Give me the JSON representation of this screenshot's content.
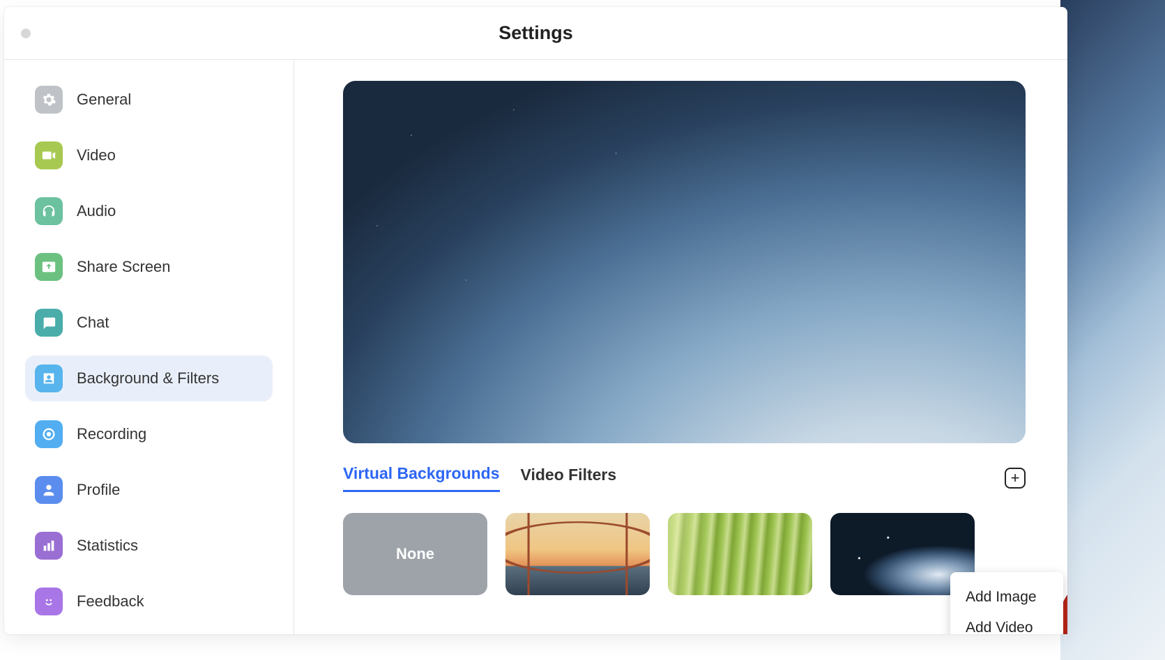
{
  "window": {
    "title": "Settings"
  },
  "sidebar": {
    "items": [
      {
        "label": "General",
        "icon": "gear-icon",
        "color": "#bfc3c8"
      },
      {
        "label": "Video",
        "icon": "video-icon",
        "color": "#a7c951"
      },
      {
        "label": "Audio",
        "icon": "headphones-icon",
        "color": "#6cc19f"
      },
      {
        "label": "Share Screen",
        "icon": "share-screen-icon",
        "color": "#6cc181"
      },
      {
        "label": "Chat",
        "icon": "chat-icon",
        "color": "#4aadaa"
      },
      {
        "label": "Background & Filters",
        "icon": "person-box-icon",
        "color": "#57b4ed",
        "active": true
      },
      {
        "label": "Recording",
        "icon": "record-icon",
        "color": "#53aef1"
      },
      {
        "label": "Profile",
        "icon": "profile-icon",
        "color": "#5b8def"
      },
      {
        "label": "Statistics",
        "icon": "stats-icon",
        "color": "#9a6fd4"
      },
      {
        "label": "Feedback",
        "icon": "smile-icon",
        "color": "#a876e6"
      }
    ]
  },
  "main": {
    "tabs": [
      {
        "label": "Virtual Backgrounds",
        "active": true
      },
      {
        "label": "Video Filters",
        "active": false
      }
    ],
    "add_button_glyph": "+",
    "thumbnails": {
      "none_label": "None"
    },
    "dropdown": {
      "add_image": "Add Image",
      "add_video": "Add Video"
    }
  }
}
